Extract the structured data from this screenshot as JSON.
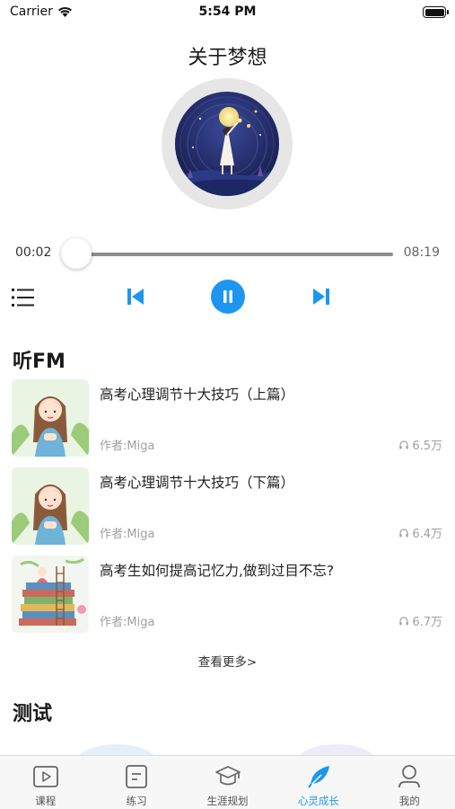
{
  "status_bar": {
    "carrier": "Carrier",
    "time": "5:54 PM"
  },
  "player": {
    "title": "关于梦想",
    "current_time": "00:02",
    "total_time": "08:19",
    "progress": 0.004,
    "state": "playing"
  },
  "fm": {
    "heading": "听FM",
    "items": [
      {
        "title": "高考心理调节十大技巧（上篇）",
        "author": "作者:Miga",
        "plays": "6.5万"
      },
      {
        "title": "高考心理调节十大技巧（下篇）",
        "author": "作者:Miga",
        "plays": "6.4万"
      },
      {
        "title": "高考生如何提高记忆力,做到过目不忘?",
        "author": "作者:Miga",
        "plays": "6.7万"
      }
    ],
    "more_label": "查看更多>"
  },
  "test": {
    "heading": "测试"
  },
  "tabbar": {
    "active_color": "#1e96f0",
    "tabs": [
      {
        "label": "课程",
        "icon": "play-square-icon"
      },
      {
        "label": "练习",
        "icon": "document-icon"
      },
      {
        "label": "生涯规划",
        "icon": "graduation-cap-icon"
      },
      {
        "label": "心灵成长",
        "icon": "feather-icon",
        "active": true
      },
      {
        "label": "我的",
        "icon": "person-icon"
      }
    ]
  }
}
